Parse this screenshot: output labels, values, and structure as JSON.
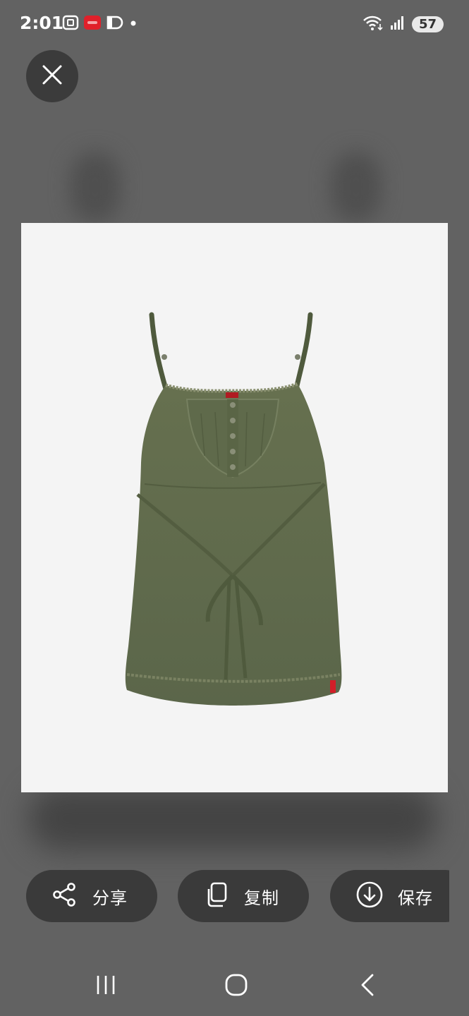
{
  "status_bar": {
    "time": "2:01",
    "battery": "57",
    "left_icons": [
      "screenshot-icon",
      "app-notification-icon",
      "app-notification-icon",
      "dot-icon"
    ],
    "right_icons": [
      "wifi-icon",
      "signal-icon",
      "battery-icon"
    ]
  },
  "viewer": {
    "close_icon": "close-icon",
    "image": {
      "background": "#f4f4f4",
      "garment_color": "#5e6a4a"
    }
  },
  "actions": [
    {
      "label": "分享",
      "icon": "share-icon"
    },
    {
      "label": "复制",
      "icon": "copy-icon"
    },
    {
      "label": "保存",
      "icon": "download-icon"
    }
  ],
  "nav_bar": {
    "icons": [
      "recent-apps-icon",
      "home-icon",
      "back-icon"
    ]
  },
  "colors": {
    "background": "#626262",
    "button": "#3a3a3a",
    "accent_red": "#e0202a"
  }
}
